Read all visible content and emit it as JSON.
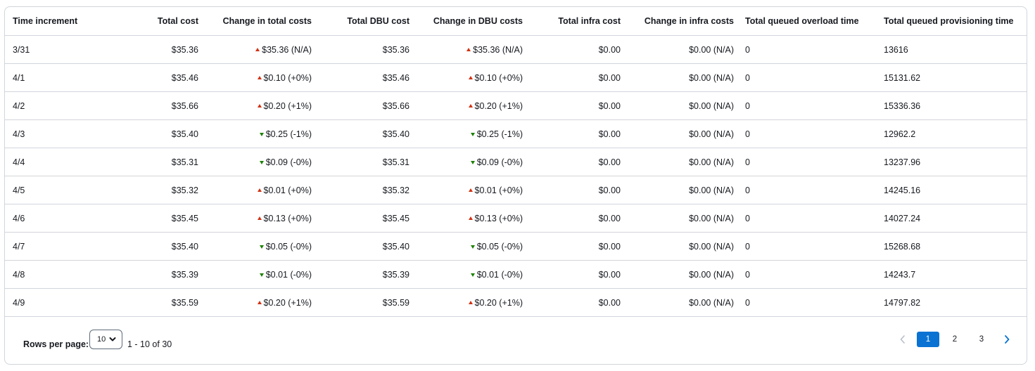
{
  "table": {
    "headers": [
      "Time increment",
      "Total cost",
      "Change in total costs",
      "Total DBU cost",
      "Change in DBU costs",
      "Total infra cost",
      "Change in infra costs",
      "Total queued overload time",
      "Total queued provisioning time"
    ],
    "rows": [
      {
        "time": "3/31",
        "total_cost": "$35.36",
        "total_change": "$35.36 (N/A)",
        "total_dir": "up",
        "dbu_cost": "$35.36",
        "dbu_change": "$35.36 (N/A)",
        "dbu_dir": "up",
        "infra_cost": "$0.00",
        "infra_change": "$0.00 (N/A)",
        "overload": "0",
        "provisioning": "13616"
      },
      {
        "time": "4/1",
        "total_cost": "$35.46",
        "total_change": "$0.10 (+0%)",
        "total_dir": "up",
        "dbu_cost": "$35.46",
        "dbu_change": "$0.10 (+0%)",
        "dbu_dir": "up",
        "infra_cost": "$0.00",
        "infra_change": "$0.00 (N/A)",
        "overload": "0",
        "provisioning": "15131.62"
      },
      {
        "time": "4/2",
        "total_cost": "$35.66",
        "total_change": "$0.20 (+1%)",
        "total_dir": "up",
        "dbu_cost": "$35.66",
        "dbu_change": "$0.20 (+1%)",
        "dbu_dir": "up",
        "infra_cost": "$0.00",
        "infra_change": "$0.00 (N/A)",
        "overload": "0",
        "provisioning": "15336.36"
      },
      {
        "time": "4/3",
        "total_cost": "$35.40",
        "total_change": "$0.25 (-1%)",
        "total_dir": "down",
        "dbu_cost": "$35.40",
        "dbu_change": "$0.25 (-1%)",
        "dbu_dir": "down",
        "infra_cost": "$0.00",
        "infra_change": "$0.00 (N/A)",
        "overload": "0",
        "provisioning": "12962.2"
      },
      {
        "time": "4/4",
        "total_cost": "$35.31",
        "total_change": "$0.09 (-0%)",
        "total_dir": "down",
        "dbu_cost": "$35.31",
        "dbu_change": "$0.09 (-0%)",
        "dbu_dir": "down",
        "infra_cost": "$0.00",
        "infra_change": "$0.00 (N/A)",
        "overload": "0",
        "provisioning": "13237.96"
      },
      {
        "time": "4/5",
        "total_cost": "$35.32",
        "total_change": "$0.01 (+0%)",
        "total_dir": "up",
        "dbu_cost": "$35.32",
        "dbu_change": "$0.01 (+0%)",
        "dbu_dir": "up",
        "infra_cost": "$0.00",
        "infra_change": "$0.00 (N/A)",
        "overload": "0",
        "provisioning": "14245.16"
      },
      {
        "time": "4/6",
        "total_cost": "$35.45",
        "total_change": "$0.13 (+0%)",
        "total_dir": "up",
        "dbu_cost": "$35.45",
        "dbu_change": "$0.13 (+0%)",
        "dbu_dir": "up",
        "infra_cost": "$0.00",
        "infra_change": "$0.00 (N/A)",
        "overload": "0",
        "provisioning": "14027.24"
      },
      {
        "time": "4/7",
        "total_cost": "$35.40",
        "total_change": "$0.05 (-0%)",
        "total_dir": "down",
        "dbu_cost": "$35.40",
        "dbu_change": "$0.05 (-0%)",
        "dbu_dir": "down",
        "infra_cost": "$0.00",
        "infra_change": "$0.00 (N/A)",
        "overload": "0",
        "provisioning": "15268.68"
      },
      {
        "time": "4/8",
        "total_cost": "$35.39",
        "total_change": "$0.01 (-0%)",
        "total_dir": "down",
        "dbu_cost": "$35.39",
        "dbu_change": "$0.01 (-0%)",
        "dbu_dir": "down",
        "infra_cost": "$0.00",
        "infra_change": "$0.00 (N/A)",
        "overload": "0",
        "provisioning": "14243.7"
      },
      {
        "time": "4/9",
        "total_cost": "$35.59",
        "total_change": "$0.20 (+1%)",
        "total_dir": "up",
        "dbu_cost": "$35.59",
        "dbu_change": "$0.20 (+1%)",
        "dbu_dir": "up",
        "infra_cost": "$0.00",
        "infra_change": "$0.00 (N/A)",
        "overload": "0",
        "provisioning": "14797.82"
      }
    ]
  },
  "footer": {
    "rows_per_page_label": "Rows per page:",
    "rows_per_page_value": "10",
    "range_text": "1 - 10 of 30",
    "pages": [
      "1",
      "2",
      "3"
    ],
    "current_page": "1",
    "prev_icon": "chevron-left-icon",
    "next_icon": "chevron-right-icon"
  },
  "colors": {
    "increase": "#d13212",
    "decrease": "#1d8102",
    "accent": "#0972d3"
  }
}
